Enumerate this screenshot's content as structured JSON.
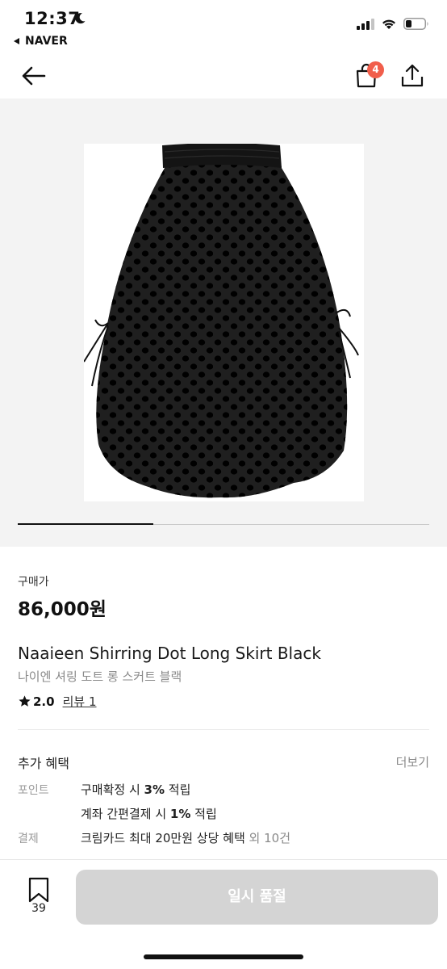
{
  "status_bar": {
    "time": "12:37",
    "back_app": "NAVER"
  },
  "nav": {
    "cart_count": "4",
    "icons": [
      "arrow-left-icon",
      "shopping-bag-icon",
      "share-icon"
    ]
  },
  "gallery": {
    "image": "black polka-dot long skirt",
    "progress_fraction": 0.33
  },
  "product": {
    "price_label": "구매가",
    "price": "86,000원",
    "name_en": "Naaieen Shirring Dot Long Skirt Black",
    "name_ko": "나이엔 셔링 도트 롱 스커트 블랙",
    "rating": "2.0",
    "review_link": "리뷰 1"
  },
  "benefits": {
    "title": "추가 혜택",
    "more": "더보기",
    "point_label": "포인트",
    "point_line1_a": "구매확정 시 ",
    "point_line1_b": "3%",
    "point_line1_c": " 적립",
    "point_line2_a": "계좌 간편결제 시 ",
    "point_line2_b": "1%",
    "point_line2_c": " 적립",
    "payment_label": "결제",
    "payment_text": "크림카드 최대 20만원 상당 혜택",
    "payment_more": " 외 10건"
  },
  "bottom": {
    "bookmark_count": "39",
    "button_label": "일시 품절"
  },
  "colors": {
    "badge": "#f15e4b",
    "button_disabled": "#d4d4d4",
    "image_bg": "#f3f3f3"
  }
}
